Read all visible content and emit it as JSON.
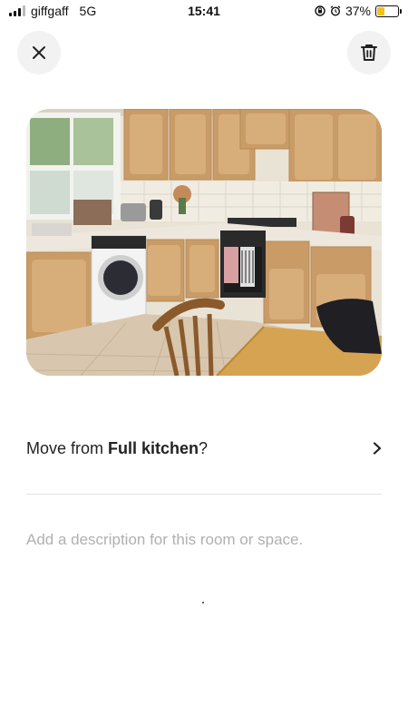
{
  "status_bar": {
    "carrier": "giffgaff",
    "network": "5G",
    "time": "15:41",
    "battery_percent": "37%",
    "battery_level": 0.37,
    "battery_color": "#f2c21b"
  },
  "toolbar": {
    "close_icon": "close-icon",
    "delete_icon": "trash-icon"
  },
  "photo": {
    "subject": "kitchen-photo"
  },
  "move": {
    "prefix": "Move from ",
    "room": "Full kitchen",
    "suffix": "?"
  },
  "description": {
    "placeholder": "Add a description for this room or space.",
    "value": ""
  }
}
